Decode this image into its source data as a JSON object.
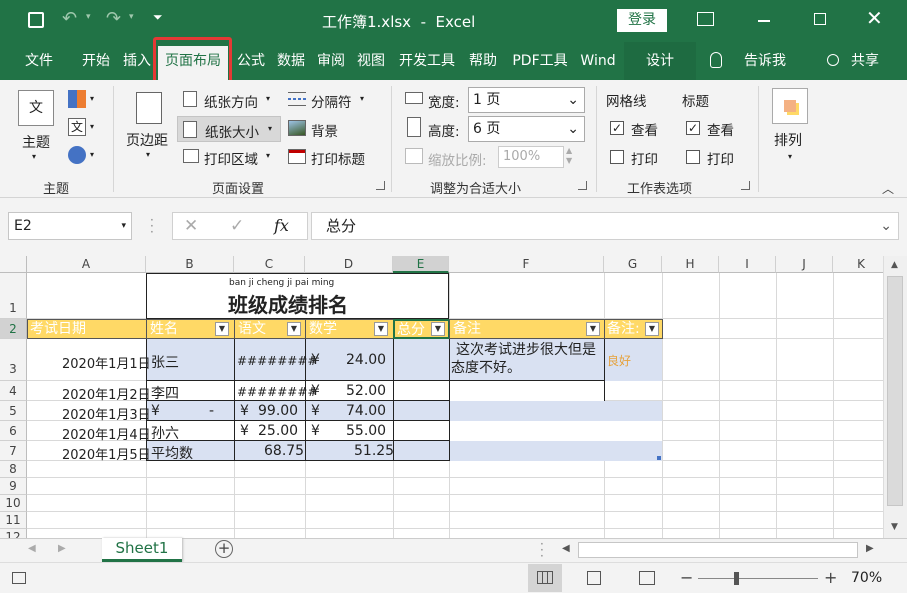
{
  "window": {
    "title": "工作簿1.xlsx  -  Excel",
    "login_label": "登录"
  },
  "tabs": [
    "文件",
    "开始",
    "插入",
    "页面布局",
    "公式",
    "数据",
    "审阅",
    "视图",
    "开发工具",
    "帮助",
    "PDF工具",
    "Wind",
    "设计"
  ],
  "active_tab": "页面布局",
  "tell_me": "告诉我",
  "share": "共享",
  "ribbon": {
    "themes": {
      "theme_label": "主题",
      "group_label": "主题"
    },
    "page_setup": {
      "margins": "页边距",
      "orientation": "纸张方向",
      "size": "纸张大小",
      "print_area": "打印区域",
      "breaks": "分隔符",
      "background": "背景",
      "print_titles": "打印标题",
      "group_label": "页面设置"
    },
    "scale": {
      "width_label": "宽度:",
      "width_value": "1 页",
      "height_label": "高度:",
      "height_value": "6 页",
      "scale_label": "缩放比例:",
      "scale_value": "100%",
      "group_label": "调整为合适大小"
    },
    "sheet_options": {
      "gridlines": "网格线",
      "headings": "标题",
      "view": "查看",
      "print": "打印",
      "group_label": "工作表选项"
    },
    "arrange": {
      "label": "排列"
    }
  },
  "formula_bar": {
    "name_box": "E2",
    "fx": "fx",
    "content": "总分"
  },
  "columns": [
    "A",
    "B",
    "C",
    "D",
    "E",
    "F",
    "G",
    "H",
    "I",
    "J",
    "K"
  ],
  "rows": [
    "1",
    "2",
    "3",
    "4",
    "5",
    "6",
    "7",
    "8",
    "9",
    "10",
    "11",
    "12"
  ],
  "sheet": {
    "phonetic": "ban ji cheng ji pai ming",
    "title": "班级成绩排名",
    "headers": [
      "考试日期",
      "姓名",
      "语文",
      "数学",
      "总分",
      "备注",
      "备注:"
    ],
    "data": [
      {
        "date": "2020年1月1日",
        "name": "张三",
        "chinese": "########",
        "math_sym": "¥",
        "math": "24.00",
        "note": "这次考试进步很大但是态度不好。",
        "note2": "良好"
      },
      {
        "date": "2020年1月2日",
        "name": "李四",
        "chinese": "########",
        "math_sym": "¥",
        "math": "52.00"
      },
      {
        "date": "2020年1月3日",
        "name_sym": "¥",
        "name_val": "-",
        "chinese_sym": "¥",
        "chinese": "99.00",
        "math_sym": "¥",
        "math": "74.00"
      },
      {
        "date": "2020年1月4日",
        "name": "孙六",
        "chinese_sym": "¥",
        "chinese": "25.00",
        "math_sym": "¥",
        "math": "55.00"
      },
      {
        "date": "2020年1月5日",
        "name": "平均数",
        "chinese": "68.75",
        "math": "51.25"
      }
    ]
  },
  "sheet_tabs": [
    "Sheet1"
  ],
  "status": {
    "zoom": "70%"
  },
  "colors": {
    "excel_green": "#217346",
    "header_yellow": "#ffd966",
    "band_blue": "#d9e1f2",
    "highlight_red": "#e53935"
  }
}
